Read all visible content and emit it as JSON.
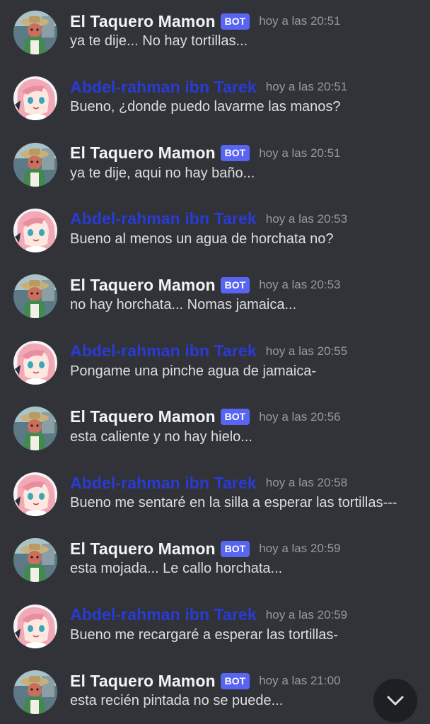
{
  "colors": {
    "background": "#313338",
    "bot_name": "#f2f3f5",
    "user_name": "#2a3bd4",
    "bot_badge": "#5865f2",
    "timestamp": "#949ba4",
    "message_text": "#dbdee1"
  },
  "bot_badge_label": "BOT",
  "messages": [
    {
      "author": "El Taquero Mamon",
      "is_bot": true,
      "avatar_icon": "taquero-avatar-icon",
      "time": "hoy a las 20:51",
      "text": "ya te dije... No hay tortillas..."
    },
    {
      "author": "Abdel-rahman ibn Tarek",
      "is_bot": false,
      "avatar_icon": "anime-girl-avatar-icon",
      "time": "hoy a las 20:51",
      "text": "Bueno, ¿donde puedo lavarme las manos?"
    },
    {
      "author": "El Taquero Mamon",
      "is_bot": true,
      "avatar_icon": "taquero-avatar-icon",
      "time": "hoy a las 20:51",
      "text": "ya te dije, aqui no hay baño..."
    },
    {
      "author": "Abdel-rahman ibn Tarek",
      "is_bot": false,
      "avatar_icon": "anime-girl-avatar-icon",
      "time": "hoy a las 20:53",
      "text": "Bueno al menos un agua de horchata no?"
    },
    {
      "author": "El Taquero Mamon",
      "is_bot": true,
      "avatar_icon": "taquero-avatar-icon",
      "time": "hoy a las 20:53",
      "text": "no hay horchata... Nomas jamaica..."
    },
    {
      "author": "Abdel-rahman ibn Tarek",
      "is_bot": false,
      "avatar_icon": "anime-girl-avatar-icon",
      "time": "hoy a las 20:55",
      "text": "Pongame una pinche agua de jamaica-"
    },
    {
      "author": "El Taquero Mamon",
      "is_bot": true,
      "avatar_icon": "taquero-avatar-icon",
      "time": "hoy a las 20:56",
      "text": "esta caliente y no hay hielo..."
    },
    {
      "author": "Abdel-rahman ibn Tarek",
      "is_bot": false,
      "avatar_icon": "anime-girl-avatar-icon",
      "time": "hoy a las 20:58",
      "text": "Bueno me sentaré en la silla a esperar las tortillas---"
    },
    {
      "author": "El Taquero Mamon",
      "is_bot": true,
      "avatar_icon": "taquero-avatar-icon",
      "time": "hoy a las 20:59",
      "text": "esta mojada... Le callo horchata..."
    },
    {
      "author": "Abdel-rahman ibn Tarek",
      "is_bot": false,
      "avatar_icon": "anime-girl-avatar-icon",
      "time": "hoy a las 20:59",
      "text": "Bueno me recargaré a esperar las tortillas-"
    },
    {
      "author": "El Taquero Mamon",
      "is_bot": true,
      "avatar_icon": "taquero-avatar-icon",
      "time": "hoy a las 21:00",
      "text": "esta recién pintada no se puede..."
    }
  ],
  "scroll_button_icon": "chevron-down-icon"
}
